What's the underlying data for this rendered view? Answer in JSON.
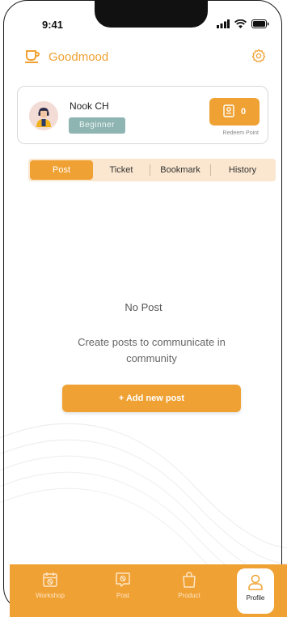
{
  "status_bar": {
    "time": "9:41"
  },
  "header": {
    "app_name": "Goodmood",
    "logo_icon": "cup-icon",
    "settings_icon": "gear-icon"
  },
  "profile": {
    "name": "Nook CH",
    "level": "Beginner",
    "points": "0",
    "points_icon": "ticket-icon",
    "redeem_label": "Redeem Point"
  },
  "tabs": [
    {
      "label": "Post",
      "active": true
    },
    {
      "label": "Ticket",
      "active": false
    },
    {
      "label": "Bookmark",
      "active": false
    },
    {
      "label": "History",
      "active": false
    }
  ],
  "empty_state": {
    "title": "No Post",
    "description": "Create posts to communicate in community",
    "button_label": "+ Add new post"
  },
  "bottom_nav": [
    {
      "label": "Workshop",
      "icon": "calendar-icon",
      "active": false
    },
    {
      "label": "Post",
      "icon": "chat-bubble-icon",
      "active": false
    },
    {
      "label": "Product",
      "icon": "shopping-bag-icon",
      "active": false
    },
    {
      "label": "Profile",
      "icon": "person-icon",
      "active": true
    }
  ],
  "colors": {
    "accent": "#f0a133",
    "badge": "#8eb5b2",
    "tab_background": "#fbe7cf"
  }
}
